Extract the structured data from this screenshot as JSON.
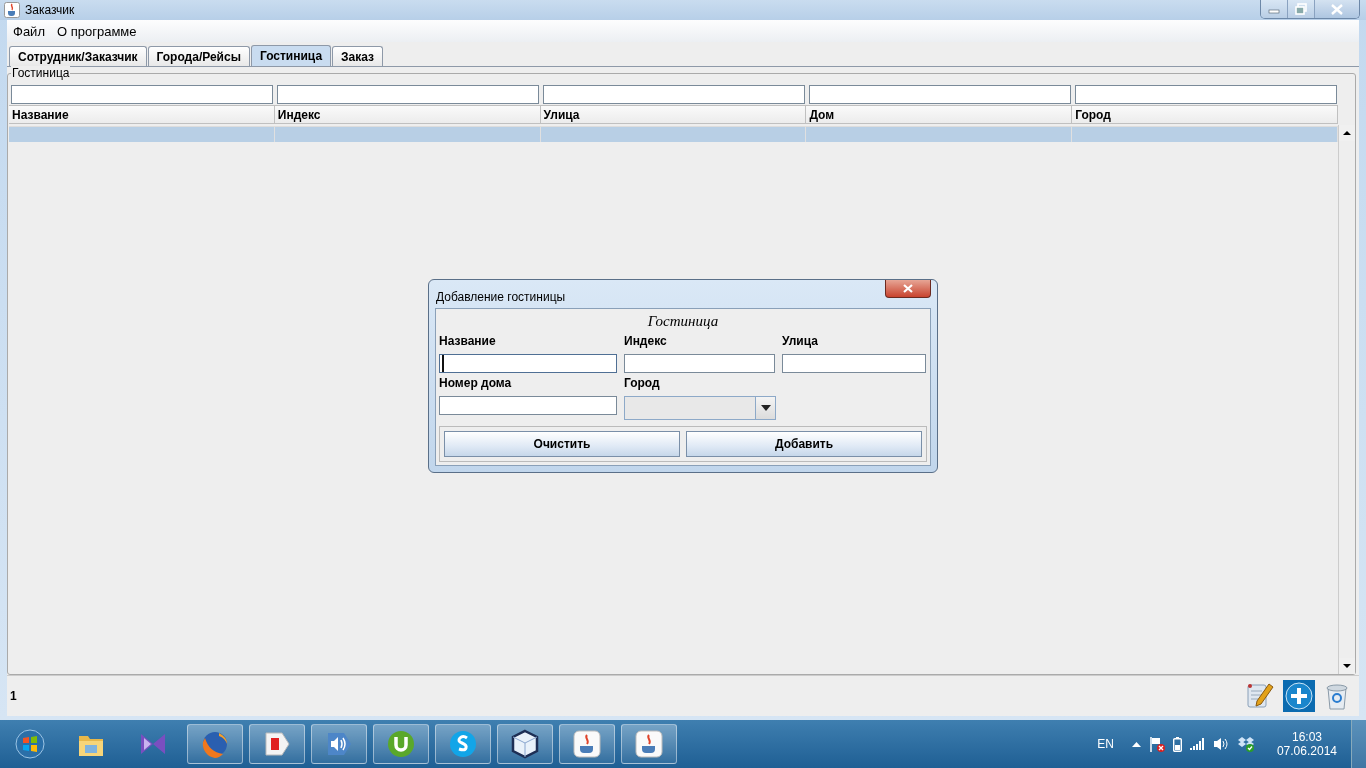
{
  "window": {
    "title": "Заказчик"
  },
  "menu": [
    "Файл",
    "О программе"
  ],
  "tabs": [
    {
      "label": "Сотрудник/Заказчик",
      "selected": false
    },
    {
      "label": "Города/Рейсы",
      "selected": false
    },
    {
      "label": "Гостиница",
      "selected": true
    },
    {
      "label": "Заказ",
      "selected": false
    }
  ],
  "panel": {
    "title": "Гостиница",
    "table": {
      "columns": [
        "Название",
        "Индекс",
        "Улица",
        "Дом",
        "Город"
      ],
      "rows": [
        {
          "selected": true
        }
      ]
    },
    "count": "1",
    "actions": [
      {
        "kind": "edit"
      },
      {
        "kind": "add"
      },
      {
        "kind": "delete"
      }
    ]
  },
  "dialog": {
    "title": "Добавление гостиницы",
    "heading": "Гостиница",
    "fields": [
      {
        "label": "Название",
        "kind": "text",
        "focused": true
      },
      {
        "label": "Индекс",
        "kind": "text",
        "focused": false
      },
      {
        "label": "Улица",
        "kind": "text",
        "focused": false
      },
      {
        "label": "Номер дома",
        "kind": "text",
        "focused": false
      },
      {
        "label": "Город",
        "kind": "combo",
        "disabled": true
      }
    ],
    "buttons": [
      "Очистить",
      "Добавить"
    ]
  },
  "taskbar": {
    "apps": [
      {
        "kind": "folder",
        "running": false
      },
      {
        "kind": "bowtie",
        "running": false
      },
      {
        "kind": "globe",
        "running": true
      },
      {
        "kind": "tag",
        "running": true
      },
      {
        "kind": "speaker",
        "running": true
      },
      {
        "kind": "torrent",
        "running": true
      },
      {
        "kind": "chat",
        "running": true
      },
      {
        "kind": "cube",
        "running": true
      },
      {
        "kind": "cup",
        "running": true
      },
      {
        "kind": "cup",
        "running": true
      }
    ],
    "language": "EN",
    "time": "16:03",
    "date": "07.06.2014"
  }
}
